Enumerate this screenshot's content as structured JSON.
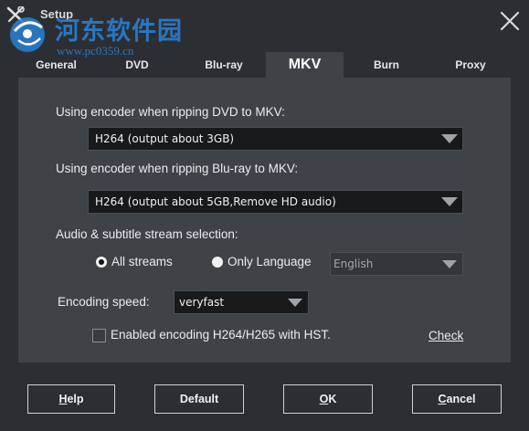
{
  "window": {
    "title": "Setup",
    "watermark_text": "河东软件园",
    "watermark_url": "www.pc0359.cn"
  },
  "tabs": [
    {
      "label": "General",
      "active": false
    },
    {
      "label": "DVD",
      "active": false
    },
    {
      "label": "Blu-ray",
      "active": false
    },
    {
      "label": "MKV",
      "active": true
    },
    {
      "label": "Burn",
      "active": false
    },
    {
      "label": "Proxy",
      "active": false
    }
  ],
  "mkv": {
    "dvd_encoder_label": "Using encoder when ripping DVD to MKV:",
    "dvd_encoder_value": "H264 (output about 3GB)",
    "bluray_encoder_label": "Using encoder when ripping Blu-ray to MKV:",
    "bluray_encoder_value": "H264 (output about 5GB,Remove HD audio)",
    "stream_selection_label": "Audio & subtitle stream selection:",
    "all_streams_label": "All streams",
    "all_streams_selected": true,
    "only_language_label": "Only Language",
    "only_language_selected": false,
    "language_value": "English",
    "encoding_speed_label": "Encoding speed:",
    "encoding_speed_value": "veryfast",
    "hst_label": "Enabled encoding H264/H265 with HST.",
    "hst_checked": false,
    "check_link": "Check"
  },
  "buttons": {
    "help_prefix": "H",
    "help_rest": "elp",
    "default": "Default",
    "ok_prefix": "O",
    "ok_rest": "K",
    "cancel_prefix": "C",
    "cancel_rest": "ancel"
  },
  "colors": {
    "background": "#2b2f33",
    "panel": "#3e4347",
    "dropdown": "#17191b",
    "watermark": "#2a7ed0"
  }
}
